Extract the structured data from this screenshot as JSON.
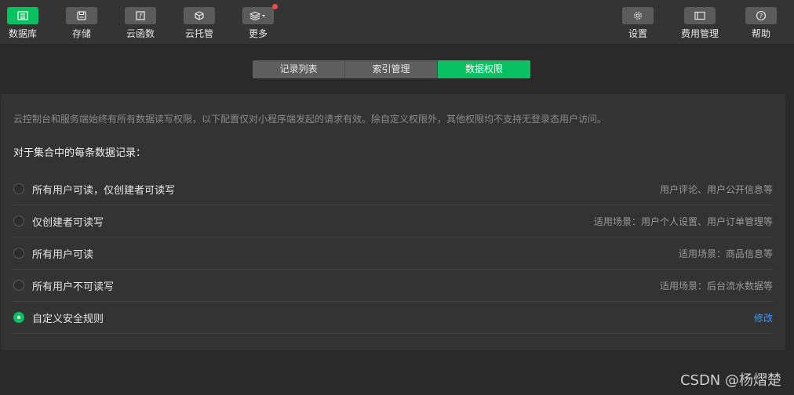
{
  "toolbar": {
    "left_items": [
      {
        "label": "数据库",
        "icon": "database-icon",
        "active": true
      },
      {
        "label": "存储",
        "icon": "storage-icon",
        "active": false
      },
      {
        "label": "云函数",
        "icon": "cloud-function-icon",
        "active": false
      },
      {
        "label": "云托管",
        "icon": "cloud-hosting-icon",
        "active": false
      },
      {
        "label": "更多",
        "icon": "layers-icon",
        "active": false,
        "has_notification_dot": true,
        "has_dropdown": true
      }
    ],
    "right_items": [
      {
        "label": "设置",
        "icon": "gear-icon"
      },
      {
        "label": "费用管理",
        "icon": "billing-icon"
      },
      {
        "label": "帮助",
        "icon": "help-icon"
      }
    ]
  },
  "tabs": [
    {
      "label": "记录列表",
      "active": false
    },
    {
      "label": "索引管理",
      "active": false
    },
    {
      "label": "数据权限",
      "active": true
    }
  ],
  "panel": {
    "notice": "云控制台和服务端始终有所有数据读写权限，以下配置仅对小程序端发起的请求有效。除自定义权限外，其他权限均不支持无登录态用户访问。",
    "subtitle": "对于集合中的每条数据记录：",
    "options": [
      {
        "label": "所有用户可读，仅创建者可读写",
        "desc": "用户评论、用户公开信息等",
        "checked": false
      },
      {
        "label": "仅创建者可读写",
        "desc": "适用场景：用户个人设置、用户订单管理等",
        "checked": false
      },
      {
        "label": "所有用户可读",
        "desc": "适用场景：商品信息等",
        "checked": false
      },
      {
        "label": "所有用户不可读写",
        "desc": "适用场景：后台流水数据等",
        "checked": false
      },
      {
        "label": "自定义安全规则",
        "link": "修改",
        "checked": true
      }
    ]
  },
  "watermark": "CSDN @杨熠楚",
  "colors": {
    "accent": "#07c160",
    "link": "#3a9bf0",
    "notification": "#f14c4c"
  }
}
